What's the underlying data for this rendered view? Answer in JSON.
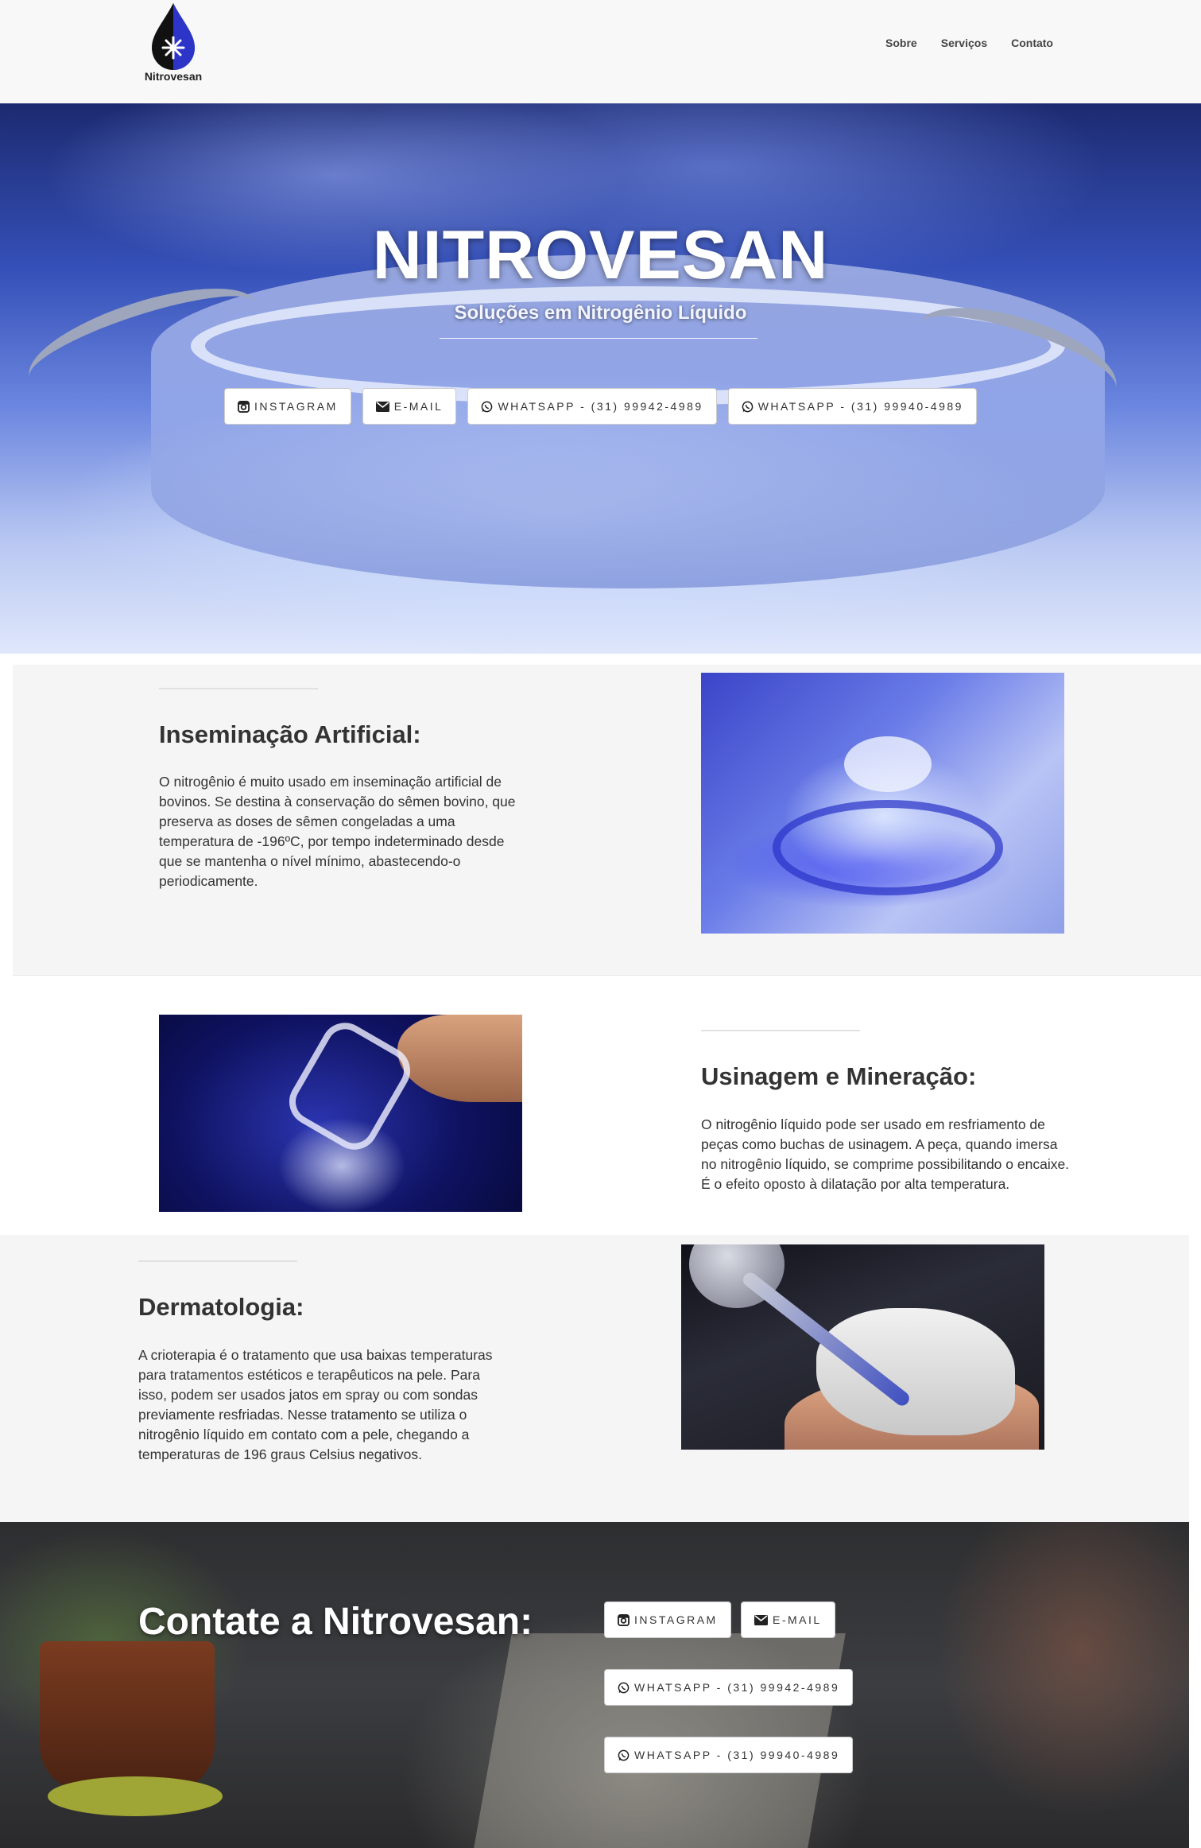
{
  "nav": {
    "logo_text": "Nitrovesan",
    "links": [
      "Sobre",
      "Serviços",
      "Contato"
    ]
  },
  "hero": {
    "title": "NITROVESAN",
    "subtitle": "Soluções em Nitrogênio Líquido",
    "buttons": {
      "instagram": "INSTAGRAM",
      "email": "E-MAIL",
      "whatsapp1": "WHATSAPP - (31) 99942-4989",
      "whatsapp2": "WHATSAPP - (31) 99940-4989"
    }
  },
  "sections": [
    {
      "heading": "Inseminação Artificial:",
      "text": "O nitrogênio é muito usado em inseminação artificial de bovinos. Se destina à conservação do sêmen bovino, que preserva as doses de sêmen congeladas a uma temperatura de -196ºC, por tempo indeterminado desde que se mantenha o nível mínimo, abastecendo-o periodicamente."
    },
    {
      "heading": "Usinagem e Mineração:",
      "text": "O nitrogênio líquido pode ser usado em resfriamento de peças como buchas de usinagem. A peça, quando imersa no nitrogênio líquido, se comprime possibilitando o encaixe. É o efeito oposto à dilatação por alta temperatura."
    },
    {
      "heading": "Dermatologia:",
      "text": "A crioterapia é o tratamento que usa baixas temperaturas para tratamentos estéticos e terapêuticos na pele. Para isso, podem ser usados jatos em spray ou com sondas previamente resfriadas. Nesse tratamento se utiliza o nitrogênio líquido em contato com a pele, chegando a temperaturas de 196 graus Celsius negativos."
    }
  ],
  "contact": {
    "title": "Contate a Nitrovesan:",
    "buttons": {
      "instagram": "INSTAGRAM",
      "email": "E-MAIL",
      "whatsapp1": "WHATSAPP - (31) 99942-4989",
      "whatsapp2": "WHATSAPP - (31) 99940-4989"
    }
  },
  "icons": {
    "logo": "nitrogen-drop-logo-icon",
    "instagram": "instagram-icon",
    "email": "envelope-icon",
    "whatsapp": "whatsapp-icon"
  },
  "colors": {
    "accent_blue": "#3a45c8",
    "nav_bg": "#f8f8f8",
    "section_grey": "#f5f5f5"
  }
}
